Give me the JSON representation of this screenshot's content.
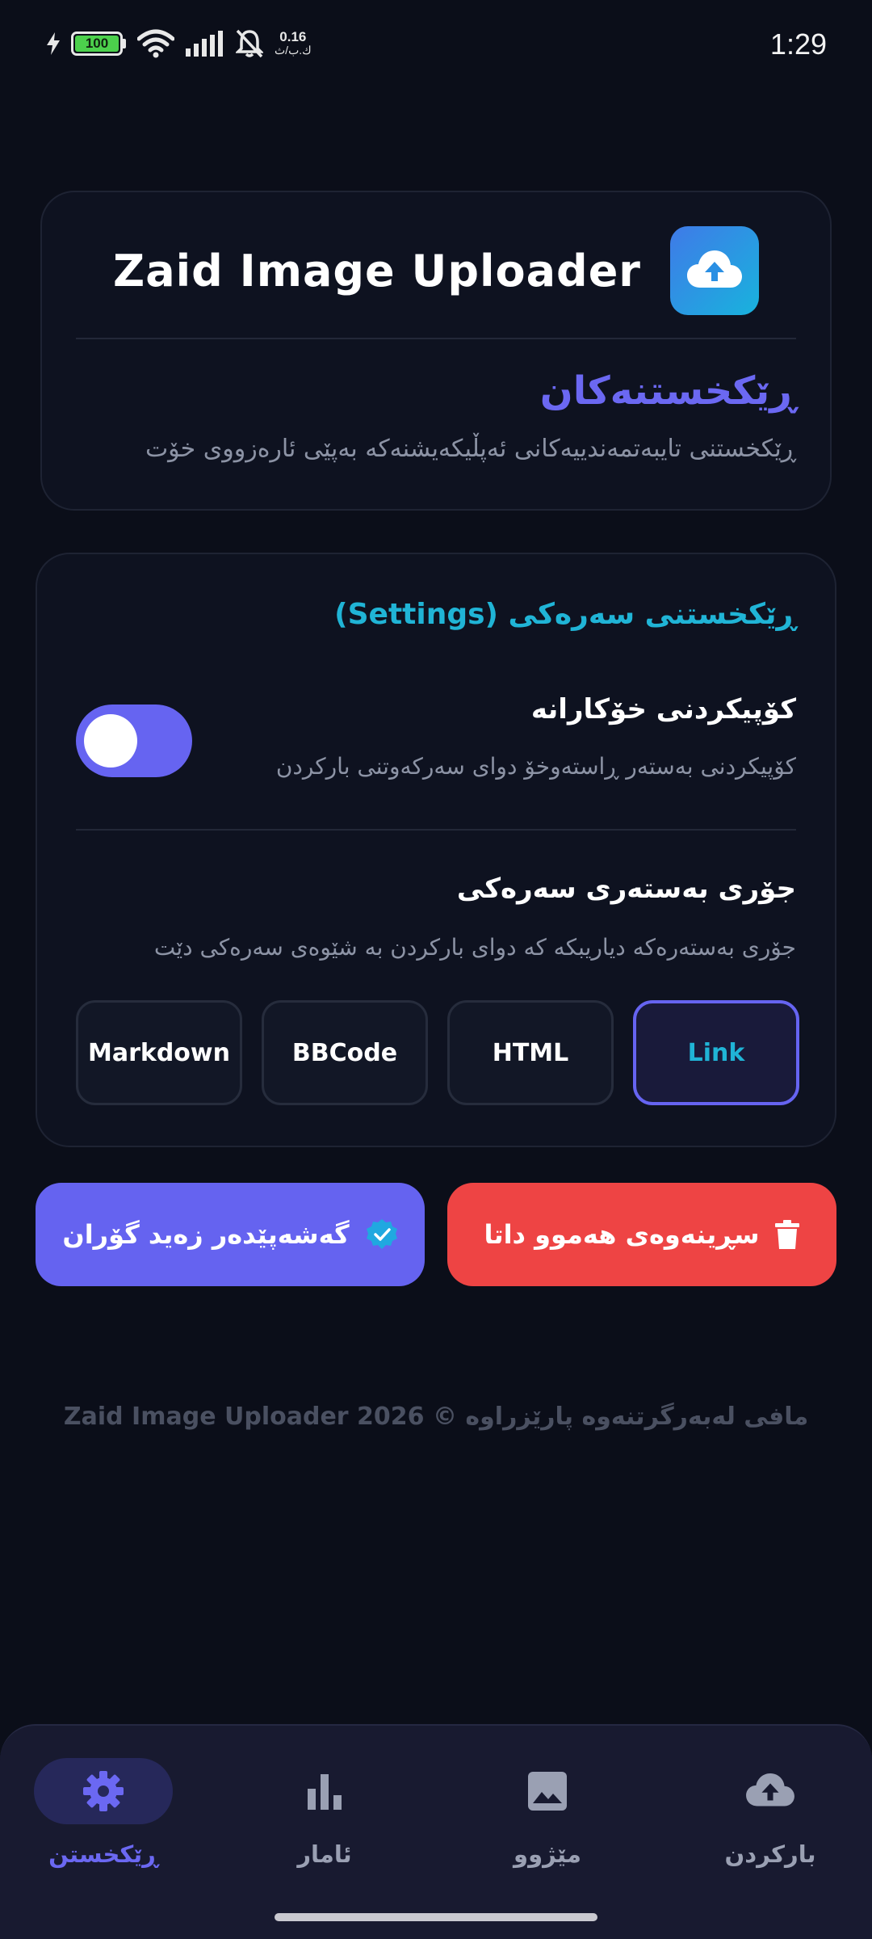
{
  "status_bar": {
    "battery": "100",
    "net_speed": "0.16",
    "net_unit": "ك.ب/ث",
    "time": "1:29"
  },
  "header_card": {
    "app_title": "Zaid Image Uploader",
    "logo_icon": "cloud-upload-icon",
    "heading": "ڕێکخستنەکان",
    "subtitle": "ڕێکخستنی تایبەتمەندییەکانی ئەپڵیکەیشنەکە بەپێی ئارەزووی خۆت"
  },
  "settings": {
    "section_title": "ڕێکخستنی سەرەکی (Settings)",
    "auto_copy": {
      "title": "کۆپیکردنی خۆکارانە",
      "desc": "کۆپیکردنی بەستەر ڕاستەوخۆ دوای سەرکەوتنی بارکردن",
      "enabled": true
    },
    "link_type": {
      "title": "جۆری بەستەری سەرەکی",
      "desc": "جۆری بەستەرەکە دیاریبکە کە دوای بارکردن بە شێوەی سەرەکی دێت",
      "options": [
        "Markdown",
        "BBCode",
        "HTML",
        "Link"
      ],
      "selected": "Link"
    }
  },
  "actions": {
    "delete_all": "سڕینەوەی هەموو داتا",
    "channel": "گەشەپێدەر زەید گۆران"
  },
  "footer": "Zaid Image Uploader 2026 © مافی لەبەرگرتنەوە پارێزراوە",
  "nav": {
    "items": [
      {
        "label": "ڕێکخستن",
        "icon": "gear-icon",
        "active": true
      },
      {
        "label": "ئامار",
        "icon": "bar-chart-icon",
        "active": false
      },
      {
        "label": "مێژوو",
        "icon": "image-icon",
        "active": false
      },
      {
        "label": "بارکردن",
        "icon": "cloud-upload-icon",
        "active": false
      }
    ]
  },
  "colors": {
    "accent": "#6563f0",
    "cyan": "#20b4d6",
    "danger": "#ee4444",
    "background": "#0b0e19"
  }
}
